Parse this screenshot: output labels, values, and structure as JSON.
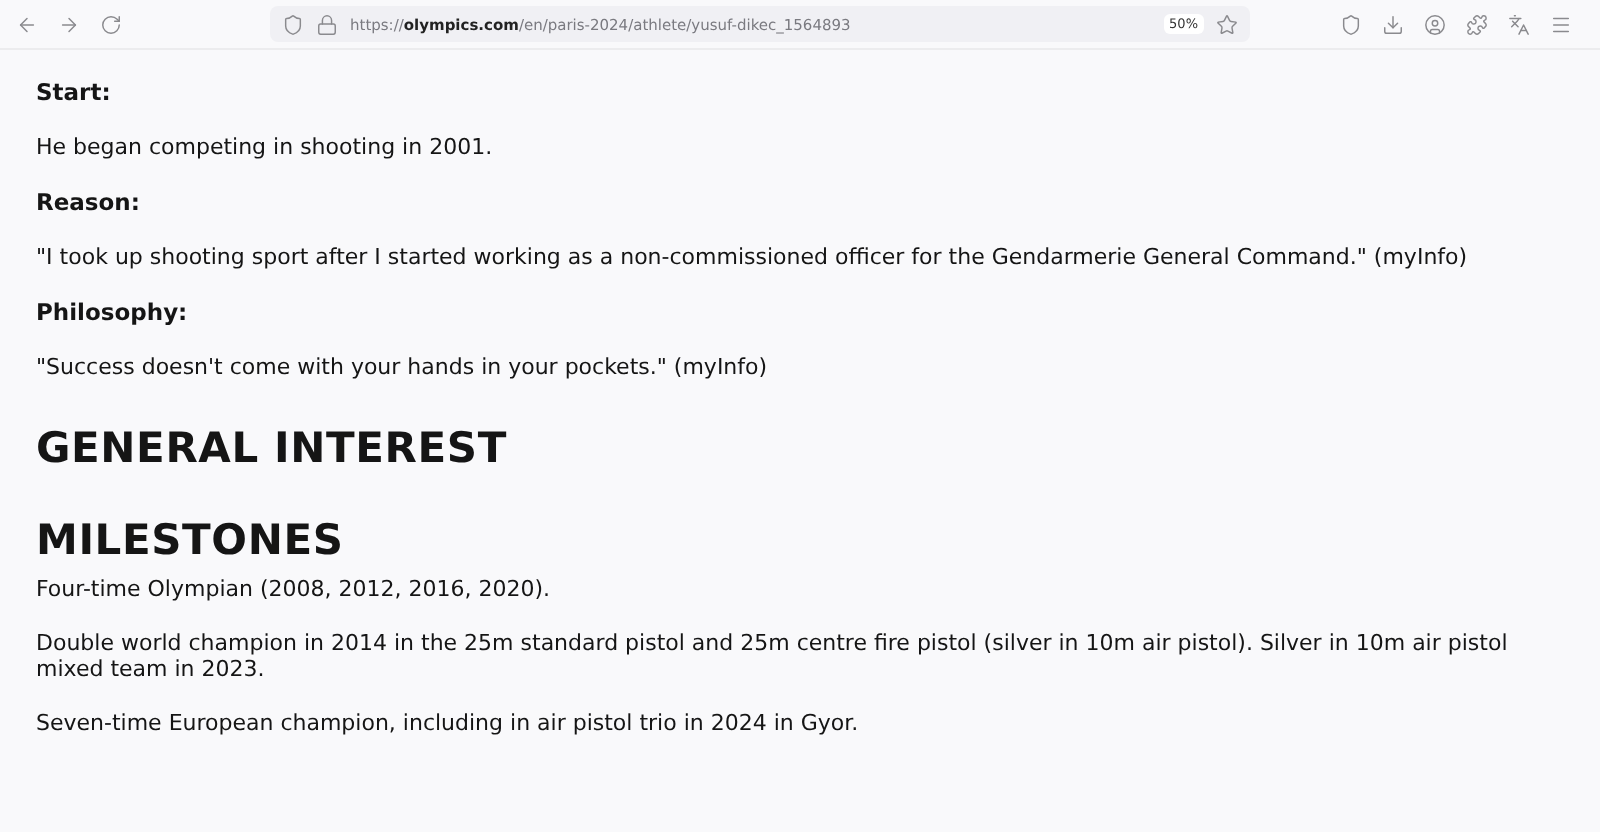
{
  "toolbar": {
    "url": "https://**olympics.com**/en/paris-2024/athlete/yusuf-dikec_1564893",
    "zoom": "50%"
  },
  "content": [
    {
      "kind": "label",
      "text": "Start:"
    },
    {
      "kind": "para",
      "text": "He began competing in shooting in 2001."
    },
    {
      "kind": "label",
      "text": "Reason:"
    },
    {
      "kind": "para",
      "text": "\"I took up shooting sport after I started working as a non-commissioned officer for the Gendarmerie General Command.\" (myInfo)"
    },
    {
      "kind": "label",
      "text": "Philosophy:"
    },
    {
      "kind": "para",
      "text": "\"Success doesn't come with your hands in your pockets.\" (myInfo)"
    },
    {
      "kind": "heading",
      "text": "GENERAL INTEREST"
    },
    {
      "kind": "heading",
      "text": "MILESTONES"
    },
    {
      "kind": "line",
      "text": "Four-time Olympian (2008, 2012, 2016, 2020)."
    },
    {
      "kind": "line",
      "text": "Double world champion in 2014 in the 25m standard pistol and 25m centre fire pistol (silver in 10m air pistol). Silver in 10m air pistol mixed team in 2023."
    },
    {
      "kind": "line",
      "text": "Seven-time European champion, including in air pistol trio in 2024 in Gyor."
    }
  ]
}
